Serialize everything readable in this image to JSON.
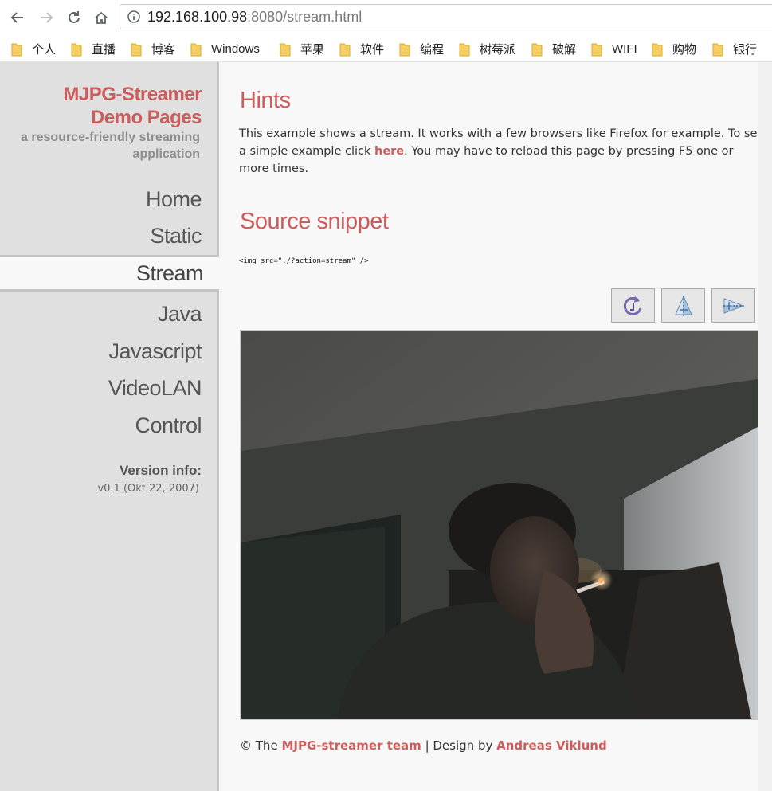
{
  "browser": {
    "url_host": "192.168.100.98",
    "url_rest": ":8080/stream.html",
    "bookmarks": [
      "个人",
      "直播",
      "博客",
      "Windows",
      "苹果",
      "软件",
      "编程",
      "树莓派",
      "破解",
      "WIFI",
      "购物",
      "银行"
    ]
  },
  "sidebar": {
    "title_line1": "MJPG-Streamer",
    "title_line2": "Demo Pages",
    "subtitle_line1": "a resource-friendly streaming",
    "subtitle_line2": "application",
    "nav": [
      "Home",
      "Static",
      "Stream",
      "Java",
      "Javascript",
      "VideoLAN",
      "Control"
    ],
    "active_item": "Stream",
    "version_label": "Version info:",
    "version_value": "v0.1 (Okt 22, 2007)"
  },
  "main": {
    "hints_title": "Hints",
    "hints_text_1": "This example shows a stream. It works with a few browsers like Firefox for example. To see a simple example click ",
    "hints_link": "here",
    "hints_text_2": ". You may have to reload this page by pressing F5 one or more times.",
    "snippet_title": "Source snippet",
    "code": "<img src=\"./?action=stream\" />",
    "toolbar_icons": [
      "rotate-icon",
      "flip-vertical-icon",
      "flip-horizontal-icon"
    ]
  },
  "footer": {
    "prefix": "© The ",
    "team_link": "MJPG-streamer team",
    "middle": " | Design by ",
    "designer_link": "Andreas Viklund"
  },
  "colors": {
    "accent": "#cd5c5c",
    "sidebar_bg": "#e0e0e0",
    "content_bg": "#f8f8f8"
  }
}
